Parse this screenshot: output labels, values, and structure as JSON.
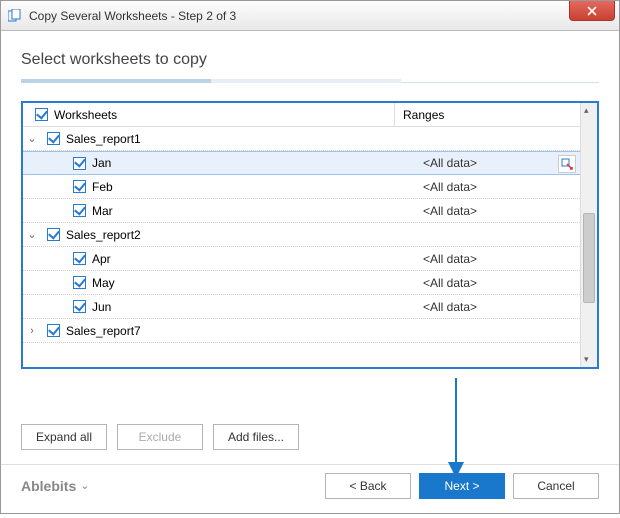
{
  "window": {
    "title": "Copy Several Worksheets - Step 2 of 3"
  },
  "heading": "Select worksheets to copy",
  "headers": {
    "worksheets": "Worksheets",
    "ranges": "Ranges"
  },
  "tree": [
    {
      "type": "book",
      "label": "Sales_report1",
      "expanded": true
    },
    {
      "type": "sheet",
      "label": "Jan",
      "range": "<All data>",
      "selected": true
    },
    {
      "type": "sheet",
      "label": "Feb",
      "range": "<All data>"
    },
    {
      "type": "sheet",
      "label": "Mar",
      "range": "<All data>"
    },
    {
      "type": "book",
      "label": "Sales_report2",
      "expanded": true
    },
    {
      "type": "sheet",
      "label": "Apr",
      "range": "<All data>"
    },
    {
      "type": "sheet",
      "label": "May",
      "range": "<All data>"
    },
    {
      "type": "sheet",
      "label": "Jun",
      "range": "<All data>"
    },
    {
      "type": "book",
      "label": "Sales_report7",
      "expanded": false
    }
  ],
  "buttons": {
    "expand_all": "Expand all",
    "exclude": "Exclude",
    "add_files": "Add files...",
    "back": "< Back",
    "next": "Next >",
    "cancel": "Cancel"
  },
  "brand": "Ablebits"
}
